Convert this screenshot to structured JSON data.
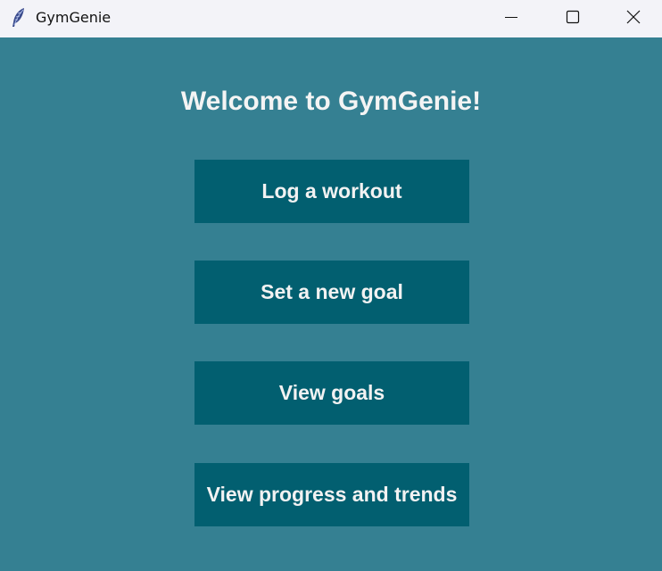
{
  "window": {
    "title": "GymGenie",
    "app_icon": "feather-icon",
    "controls": {
      "minimize": "minimize-icon",
      "maximize": "maximize-icon",
      "close": "close-icon"
    }
  },
  "main": {
    "heading": "Welcome to GymGenie!",
    "buttons": [
      {
        "label": "Log a workout"
      },
      {
        "label": "Set a new goal"
      },
      {
        "label": "View goals"
      },
      {
        "label": "View progress and trends"
      }
    ]
  },
  "colors": {
    "background": "#358092",
    "button": "#025f70",
    "text": "#f4f4f4",
    "titlebar": "#f3f3f8"
  }
}
